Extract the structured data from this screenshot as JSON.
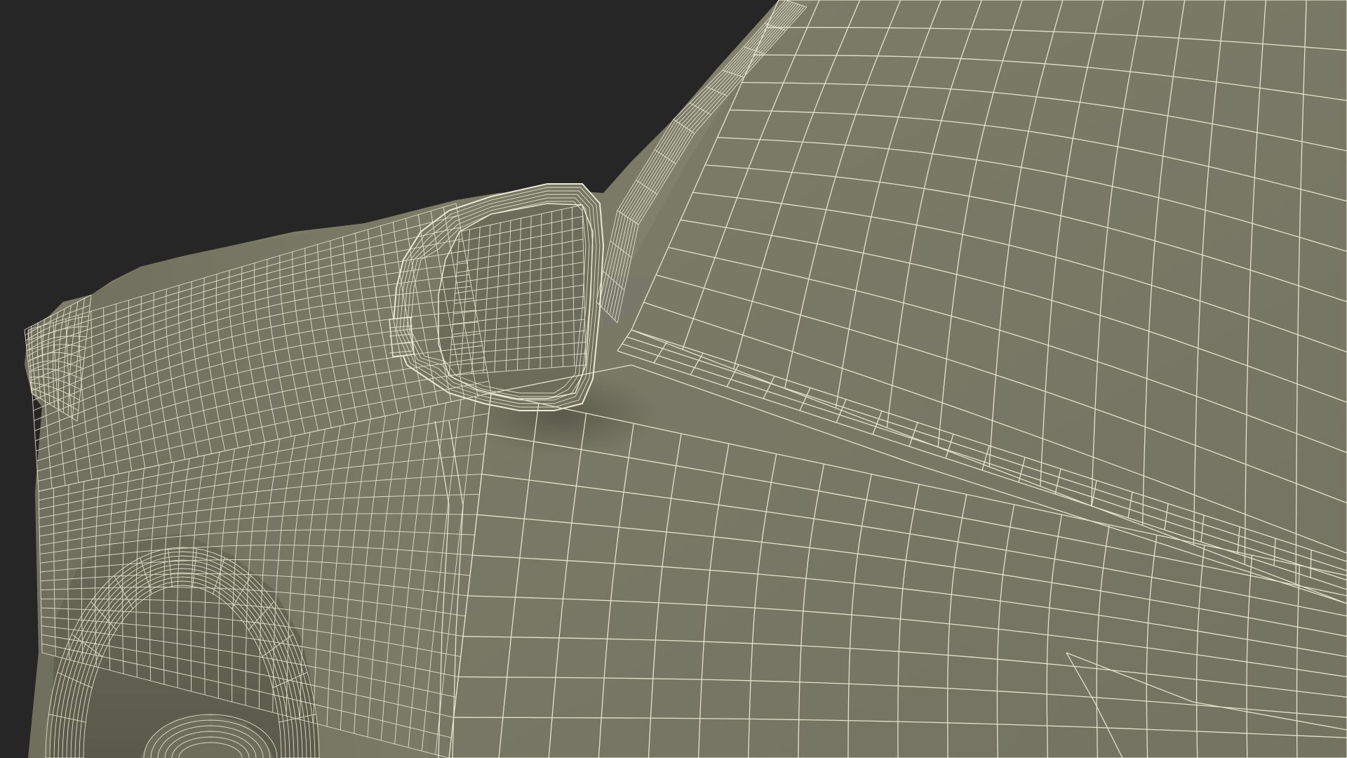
{
  "scene": {
    "subject": "wireframe-render-car-side-mirror",
    "colors": {
      "background": "#262626",
      "surface": "#7a7a66",
      "surface_light": "#878773",
      "surface_dark": "#5d5d4d",
      "wire": "#e9e8d2",
      "wire_dim": "#c9c8b0"
    }
  }
}
